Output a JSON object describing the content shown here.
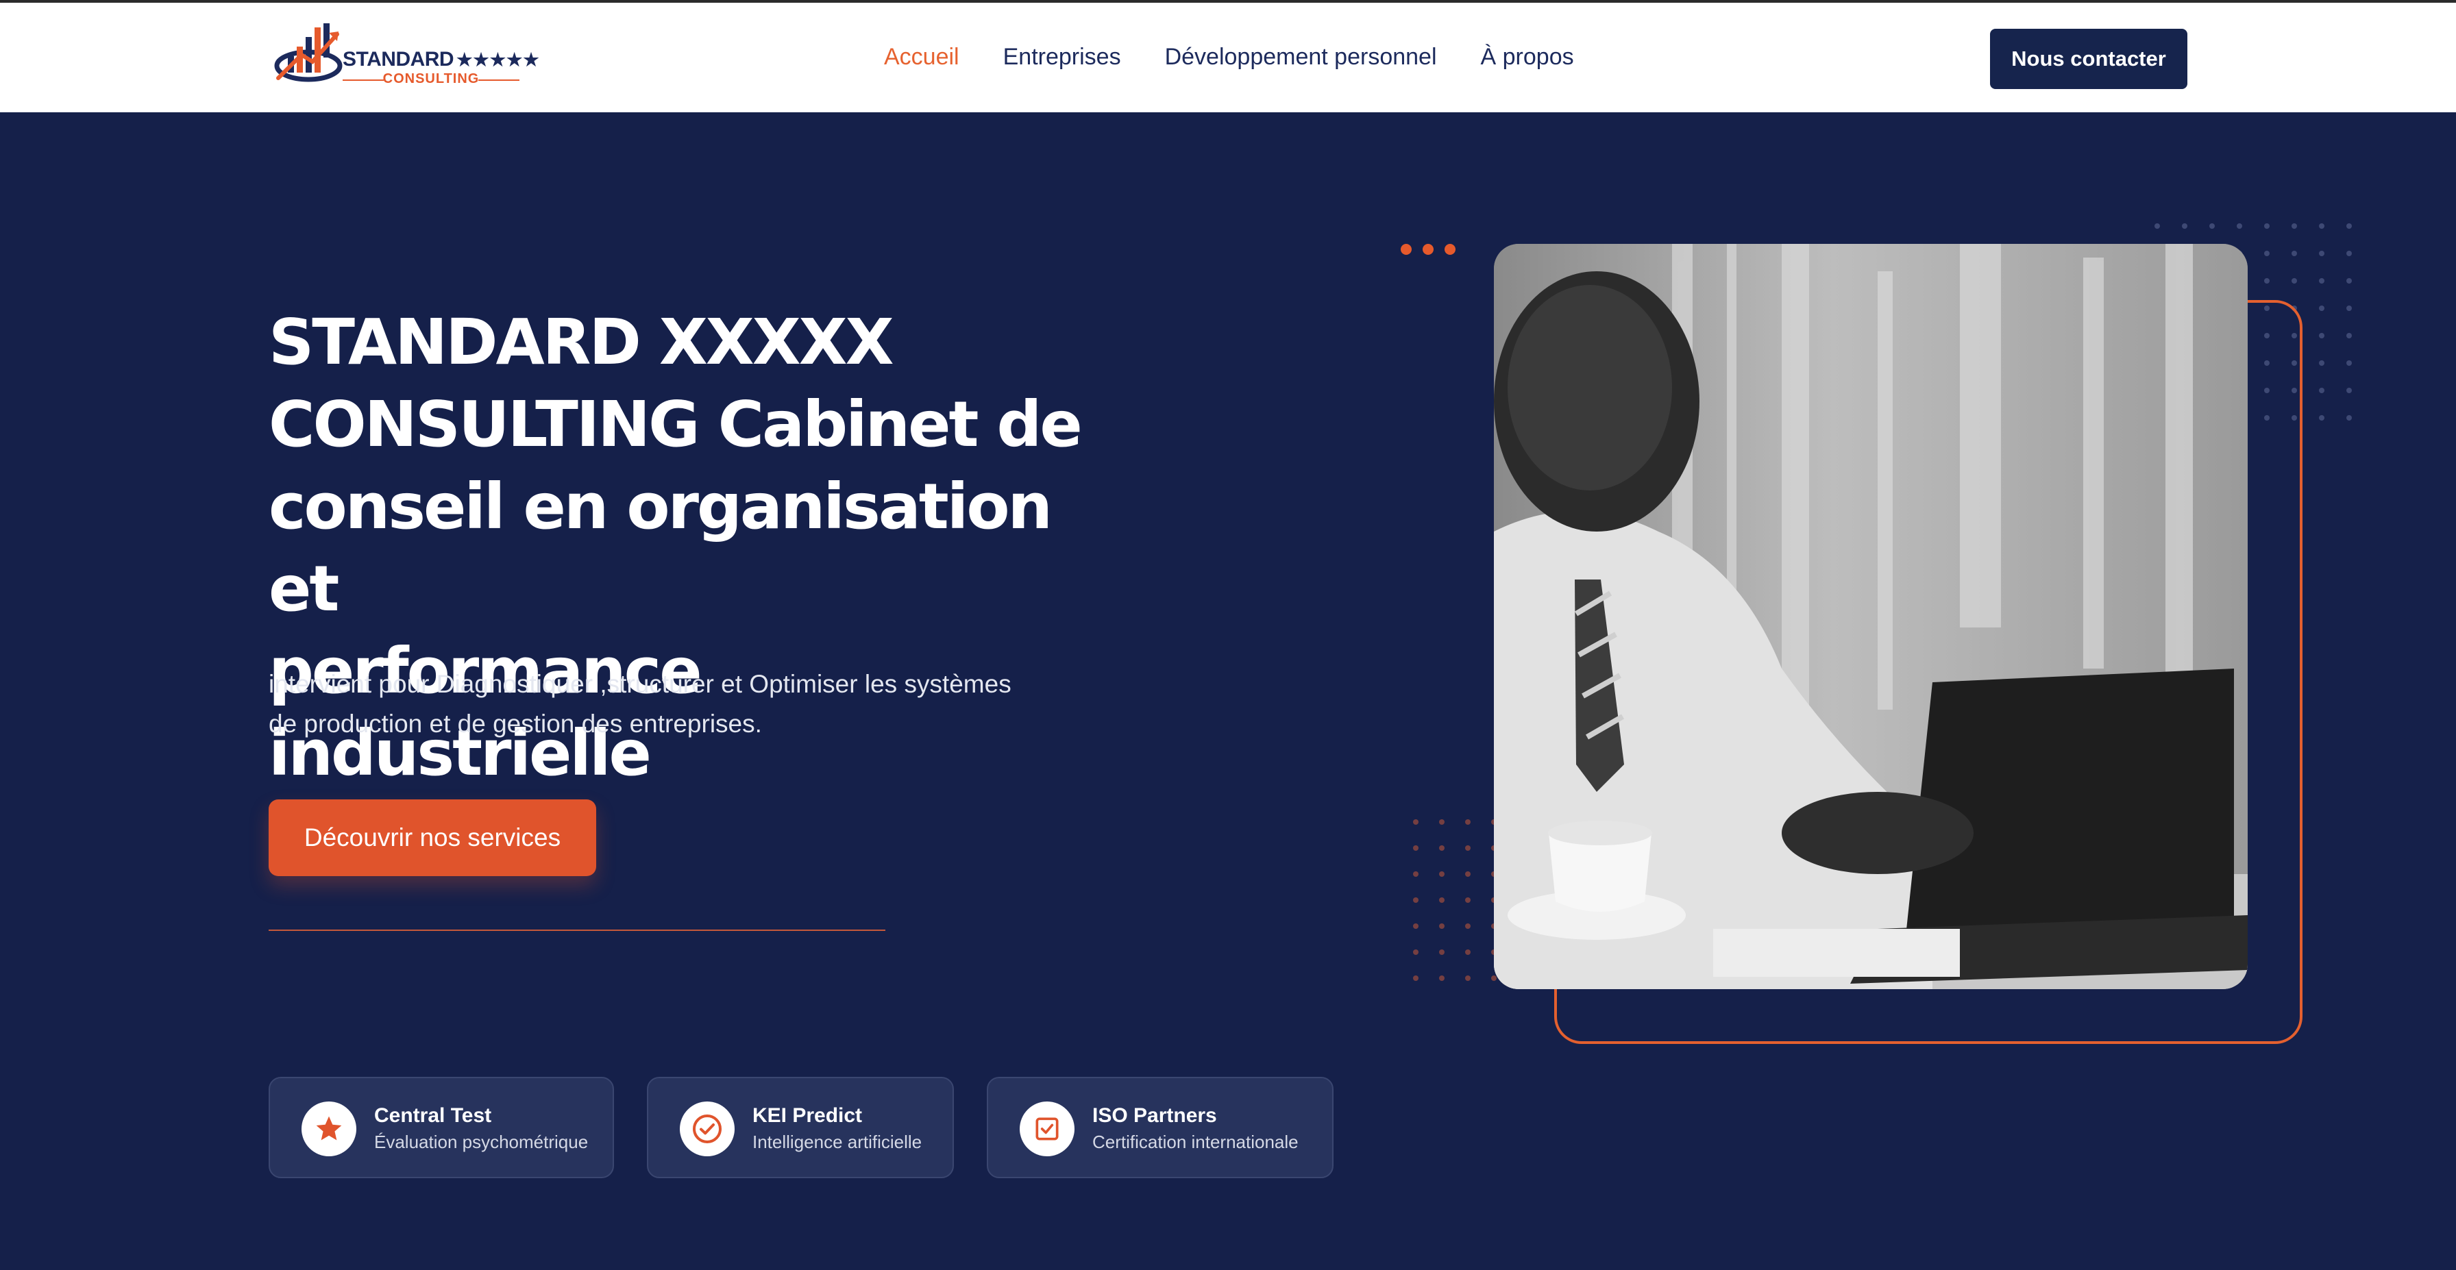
{
  "header": {
    "logo": {
      "wordmark": "STANDARD",
      "stars": "★★★★★",
      "subline": "CONSULTING"
    },
    "nav": [
      {
        "label": "Accueil",
        "active": true
      },
      {
        "label": "Entreprises",
        "active": false
      },
      {
        "label": "Développement personnel",
        "active": false
      },
      {
        "label": "À propos",
        "active": false
      }
    ],
    "contact_label": "Nous contacter"
  },
  "hero": {
    "title_line1": "STANDARD XXXXX",
    "title_line2": "CONSULTING Cabinet de",
    "title_line3": "conseil en organisation et",
    "title_line4": "performance industrielle",
    "description_line1": "intervient pour Diagnostiquer ,structurer et Optimiser les systèmes",
    "description_line2": "de production et de gestion des entreprises.",
    "cta_label": "Découvrir nos services"
  },
  "partners": [
    {
      "title": "Central Test",
      "subtitle": "Évaluation psychométrique",
      "icon": "star-icon"
    },
    {
      "title": "KEI Predict",
      "subtitle": "Intelligence artificielle",
      "icon": "check-circle-icon"
    },
    {
      "title": "ISO Partners",
      "subtitle": "Certification internationale",
      "icon": "checkbox-icon"
    }
  ],
  "colors": {
    "navy": "#15204a",
    "accent": "#e0542c",
    "header_bg": "#ffffff",
    "card_bg": "#27335d"
  }
}
